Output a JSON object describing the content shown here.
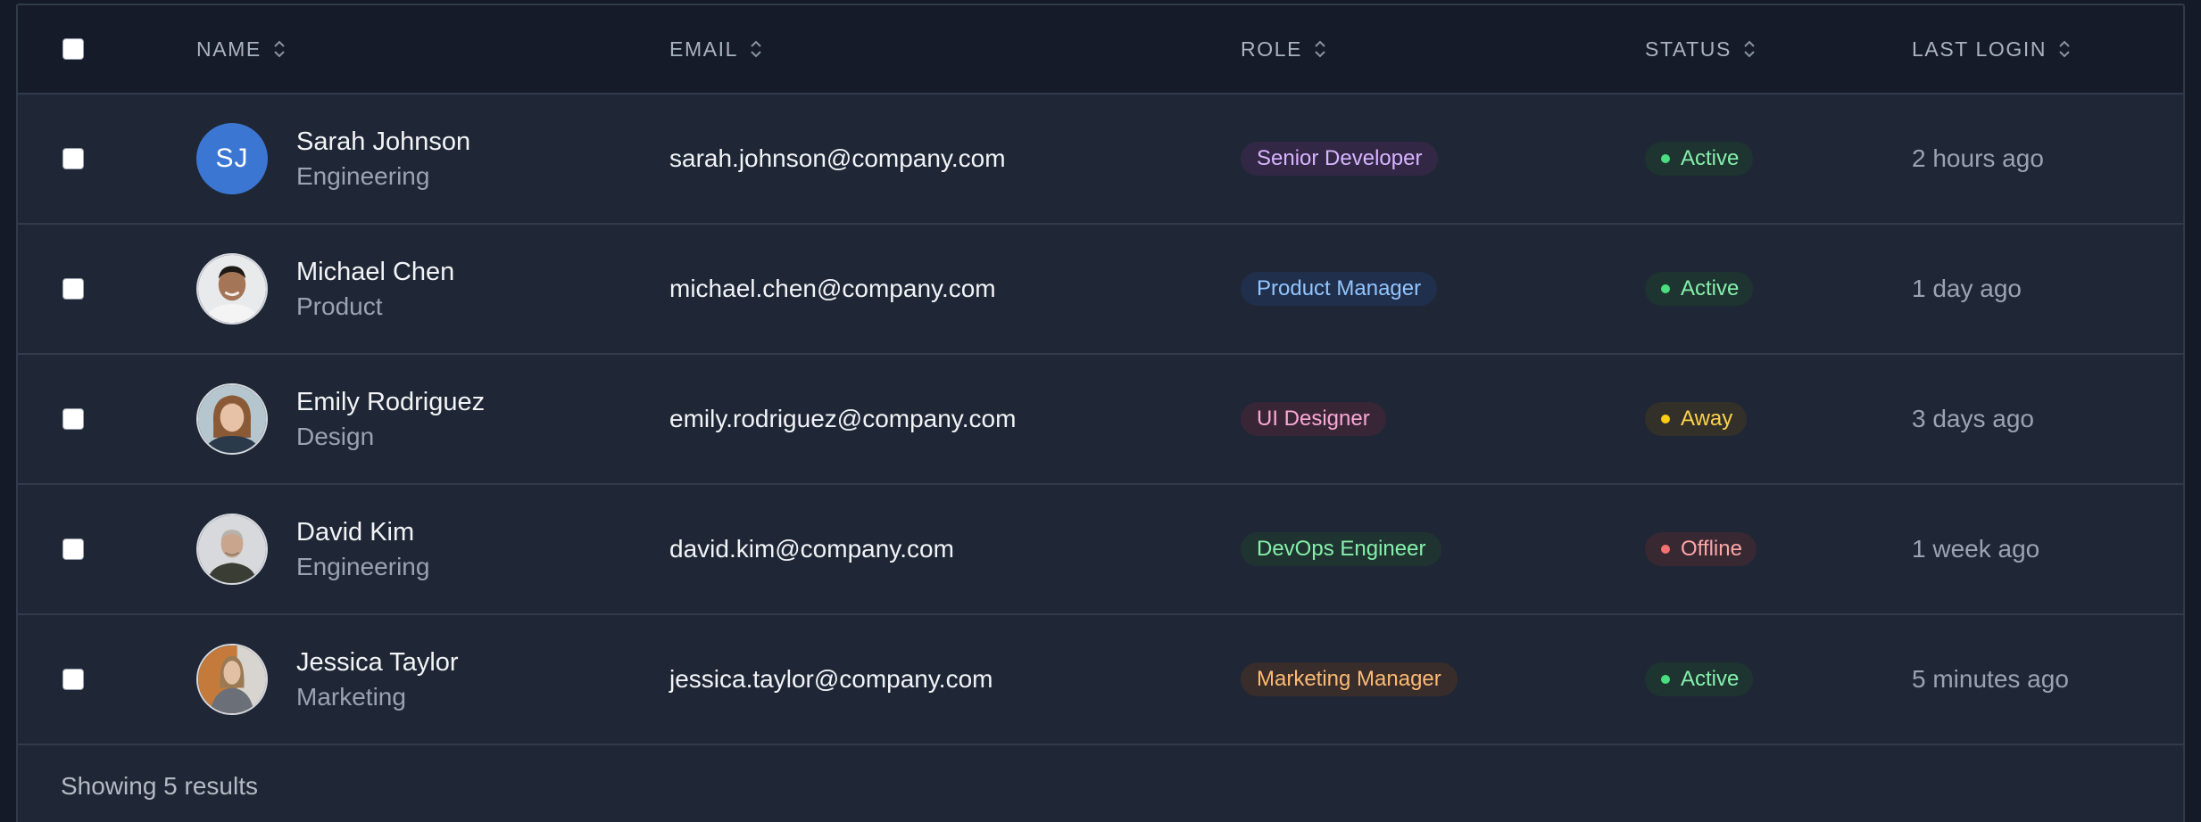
{
  "columns": {
    "name": "NAME",
    "email": "EMAIL",
    "role": "ROLE",
    "status": "STATUS",
    "last_login": "LAST LOGIN"
  },
  "rows": [
    {
      "name": "Sarah Johnson",
      "department": "Engineering",
      "initials": "SJ",
      "email": "sarah.johnson@company.com",
      "role": "Senior Developer",
      "role_color": "#d8b4fe",
      "role_bg": "#322845",
      "status": "Active",
      "status_color": "#86efac",
      "status_dot": "#4ade80",
      "status_bg": "#1e3430",
      "last_login": "2 hours ago"
    },
    {
      "name": "Michael Chen",
      "department": "Product",
      "email": "michael.chen@company.com",
      "role": "Product Manager",
      "role_color": "#93c5fd",
      "role_bg": "#1f2f4c",
      "status": "Active",
      "status_color": "#86efac",
      "status_dot": "#4ade80",
      "status_bg": "#1e3430",
      "last_login": "1 day ago"
    },
    {
      "name": "Emily Rodriguez",
      "department": "Design",
      "email": "emily.rodriguez@company.com",
      "role": "UI Designer",
      "role_color": "#f9a8d4",
      "role_bg": "#382636",
      "status": "Away",
      "status_color": "#fcd34d",
      "status_dot": "#facc15",
      "status_bg": "#33302a",
      "last_login": "3 days ago"
    },
    {
      "name": "David Kim",
      "department": "Engineering",
      "email": "david.kim@company.com",
      "role": "DevOps Engineer",
      "role_color": "#86efac",
      "role_bg": "#1f3430",
      "status": "Offline",
      "status_color": "#fca5a5",
      "status_dot": "#f87171",
      "status_bg": "#382832",
      "last_login": "1 week ago"
    },
    {
      "name": "Jessica Taylor",
      "department": "Marketing",
      "email": "jessica.taylor@company.com",
      "role": "Marketing Manager",
      "role_color": "#fdba74",
      "role_bg": "#382d2b",
      "status": "Active",
      "status_color": "#86efac",
      "status_dot": "#4ade80",
      "status_bg": "#1e3430",
      "last_login": "5 minutes ago"
    }
  ],
  "footer": {
    "results_text": "Showing 5 results"
  }
}
